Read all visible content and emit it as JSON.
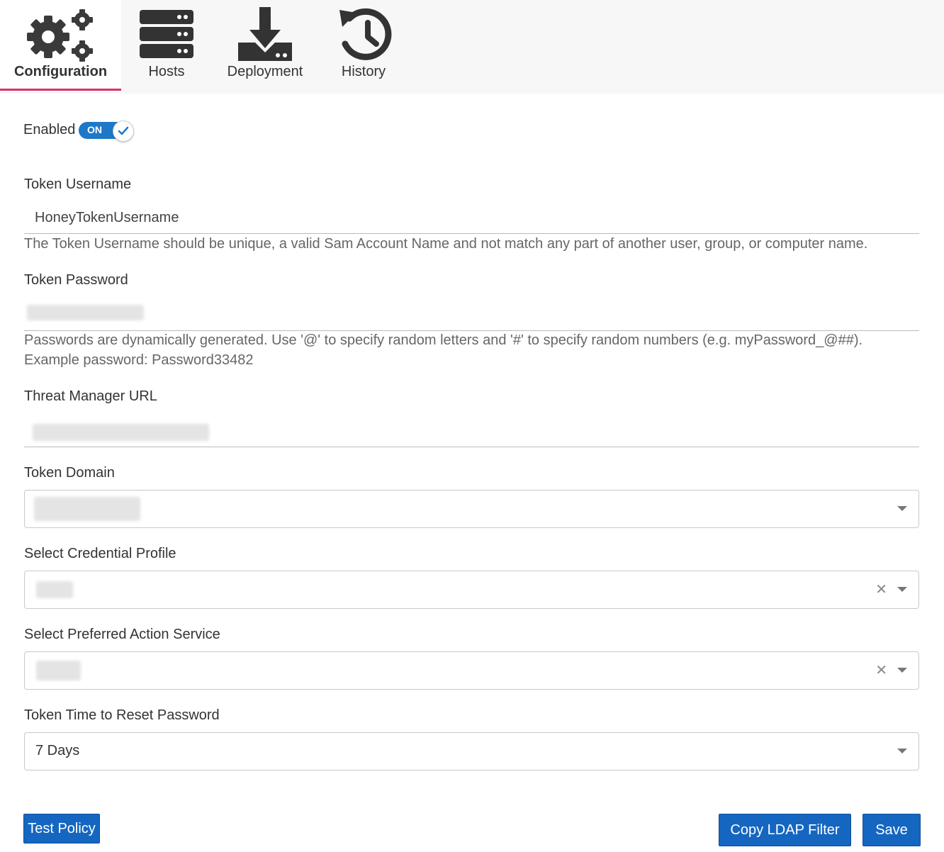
{
  "tabs": [
    {
      "label": "Configuration",
      "icon": "gears-icon",
      "active": true
    },
    {
      "label": "Hosts",
      "icon": "server-stack-icon",
      "active": false
    },
    {
      "label": "Deployment",
      "icon": "download-tray-icon",
      "active": false
    },
    {
      "label": "History",
      "icon": "history-clock-icon",
      "active": false
    }
  ],
  "enabled": {
    "label": "Enabled",
    "state": "ON",
    "on": true
  },
  "token_username": {
    "label": "Token Username",
    "value": "HoneyTokenUsername",
    "help": "The Token Username should be unique, a valid Sam Account Name and not match any part of another user, group, or computer name."
  },
  "token_password": {
    "label": "Token Password",
    "help_line1": "Passwords are dynamically generated. Use '@' to specify random letters and '#' to specify random numbers (e.g. myPassword_@##).",
    "help_line2": "Example password: Password33482"
  },
  "threat_manager_url": {
    "label": "Threat Manager URL"
  },
  "token_domain": {
    "label": "Token Domain"
  },
  "credential_profile": {
    "label": "Select Credential Profile"
  },
  "action_service": {
    "label": "Select Preferred Action Service"
  },
  "reset_password": {
    "label": "Token Time to Reset Password",
    "value": "7 Days"
  },
  "buttons": {
    "test_policy": "Test Policy",
    "copy_ldap": "Copy LDAP Filter",
    "save": "Save"
  },
  "colors": {
    "accent": "#1566c0",
    "active_tab_underline": "#d6336c",
    "toggle_on": "#1e78c8"
  }
}
